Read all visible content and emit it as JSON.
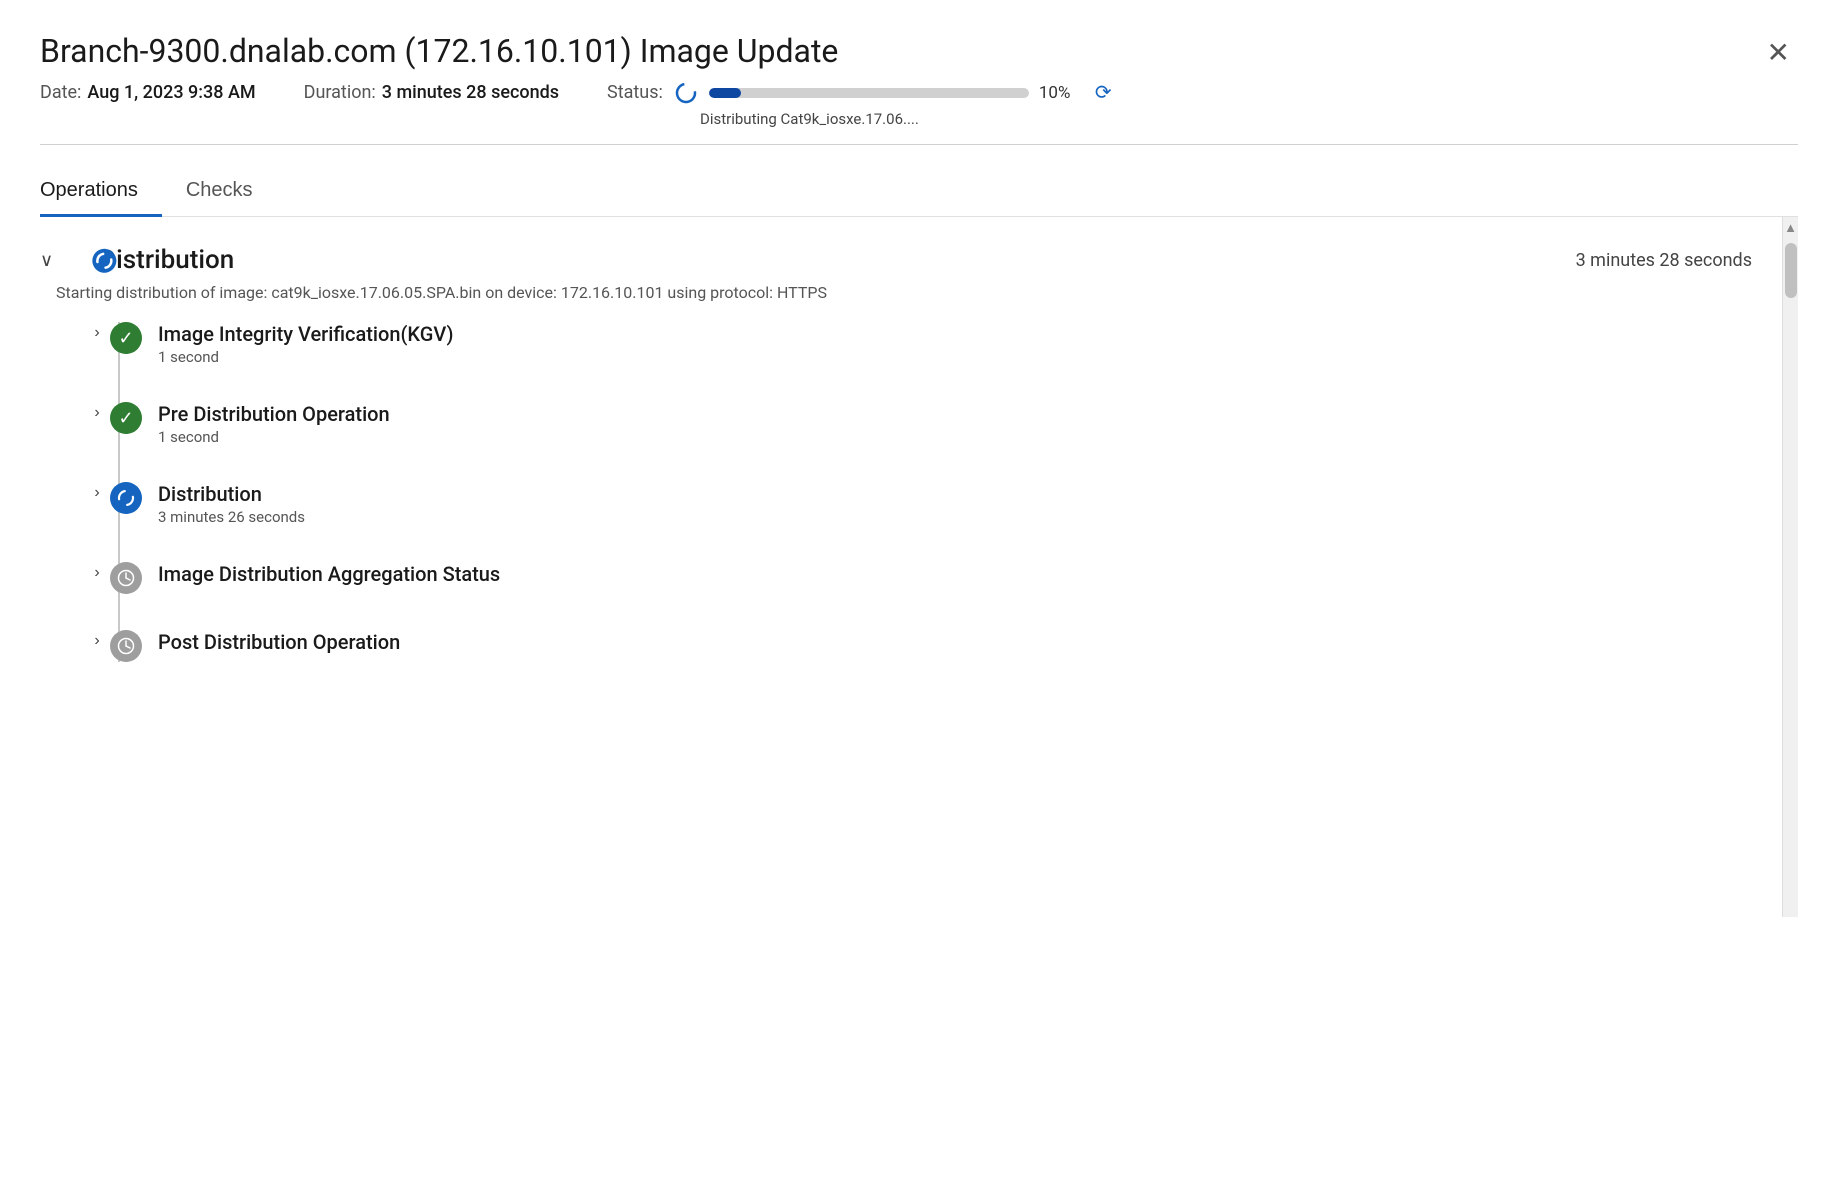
{
  "modal": {
    "title": "Branch-9300.dnalab.com (172.16.10.101) Image Update",
    "date_label": "Date:",
    "date_value": "Aug 1, 2023 9:38 AM",
    "duration_label": "Duration:",
    "duration_value": "3 minutes 28 seconds",
    "status_label": "Status:",
    "status_icon": "spinner",
    "progress_percent": "10%",
    "progress_value": 10,
    "status_sub": "Distributing Cat9k_iosxe.17.06....",
    "close_label": "×"
  },
  "tabs": [
    {
      "id": "operations",
      "label": "Operations",
      "active": true
    },
    {
      "id": "checks",
      "label": "Checks",
      "active": false
    }
  ],
  "distribution_section": {
    "title": "Distribution",
    "duration": "3 minutes 28 seconds",
    "description": "Starting distribution of image: cat9k_iosxe.17.06.05.SPA.bin on device: 172.16.10.101 using protocol: HTTPS",
    "items": [
      {
        "id": "image-integrity",
        "title": "Image Integrity Verification(KGV)",
        "duration": "1 second",
        "status": "success",
        "icon_label": "✓"
      },
      {
        "id": "pre-distribution",
        "title": "Pre Distribution Operation",
        "duration": "1 second",
        "status": "success",
        "icon_label": "✓"
      },
      {
        "id": "distribution",
        "title": "Distribution",
        "duration": "3 minutes 26 seconds",
        "status": "in-progress",
        "icon_label": "↻"
      },
      {
        "id": "aggregation-status",
        "title": "Image Distribution Aggregation Status",
        "duration": "",
        "status": "pending",
        "icon_label": "◔"
      },
      {
        "id": "post-distribution",
        "title": "Post Distribution Operation",
        "duration": "",
        "status": "pending",
        "icon_label": "◔"
      }
    ]
  },
  "icons": {
    "close": "✕",
    "chevron_down": "∨",
    "chevron_right": "›",
    "refresh": "⟳"
  }
}
